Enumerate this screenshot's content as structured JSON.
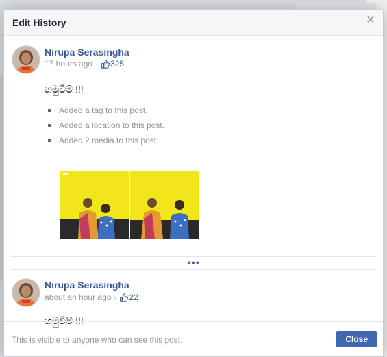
{
  "dialog": {
    "title": "Edit History",
    "close_icon": "close-icon"
  },
  "entries": [
    {
      "author": "Nirupa Serasingha",
      "time": "17 hours ago",
      "separator": "·",
      "likes": "325",
      "text": "හමුවීම් !!!",
      "changes": [
        "Added a tag to this post.",
        "Added a location to this post.",
        "Added 2 media to this post."
      ],
      "media_count": 2
    },
    {
      "author": "Nirupa Serasingha",
      "time": "about an hour ago",
      "separator": "·",
      "likes": "22",
      "text": "හමුවීම් !!!"
    }
  ],
  "more_indicator": "•••",
  "footer": {
    "note": "This is visible to anyone who can see this post.",
    "close_label": "Close"
  },
  "colors": {
    "link": "#365899",
    "button": "#4267b2",
    "muted": "#90949c",
    "photo_bg": "#f1e61a"
  }
}
